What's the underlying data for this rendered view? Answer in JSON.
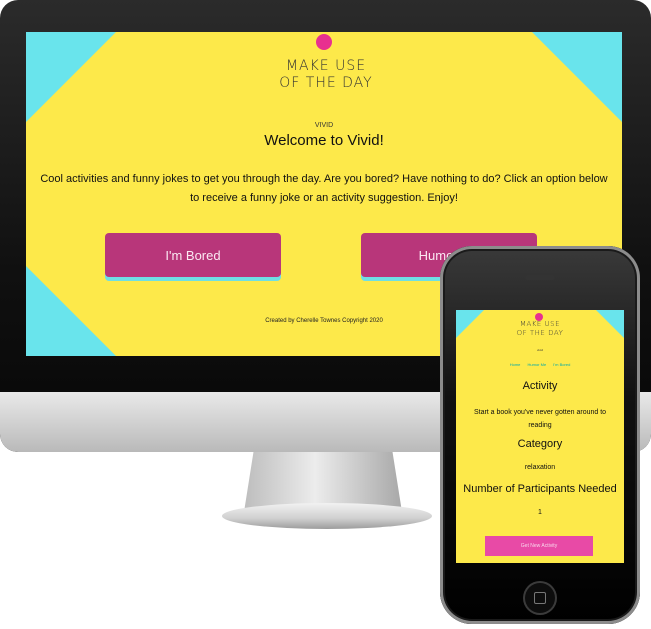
{
  "desktop": {
    "logo_line1": "MAKE USE",
    "logo_line2": "OF THE DAY",
    "nav_label": "VIVID",
    "heading": "Welcome to Vivid!",
    "intro": "Cool activities and funny jokes to get you through the day. Are you bored? Have nothing to do? Click an option below to receive a funny joke or an activity suggestion. Enjoy!",
    "button_bored": "I'm Bored",
    "button_humor": "Humor Me",
    "footer": "Created by Cherelle Townes Copyright 2020"
  },
  "phone": {
    "logo_line1": "MAKE USE",
    "logo_line2": "OF THE DAY",
    "nav_label": "vivid",
    "nav_links": [
      "Home",
      "Humor Me",
      "I'm Bored"
    ],
    "activity_heading": "Activity",
    "activity_text": "Start a book you've never gotten around to reading",
    "category_heading": "Category",
    "category_text": "relaxation",
    "participants_heading": "Number of Participants Needed",
    "participants_text": "1",
    "button_label": "Get New Activity"
  },
  "colors": {
    "background_yellow": "#fde94a",
    "corner_cyan": "#69e4ec",
    "button_magenta": "#b8367a",
    "logo_pink": "#e8308f"
  }
}
